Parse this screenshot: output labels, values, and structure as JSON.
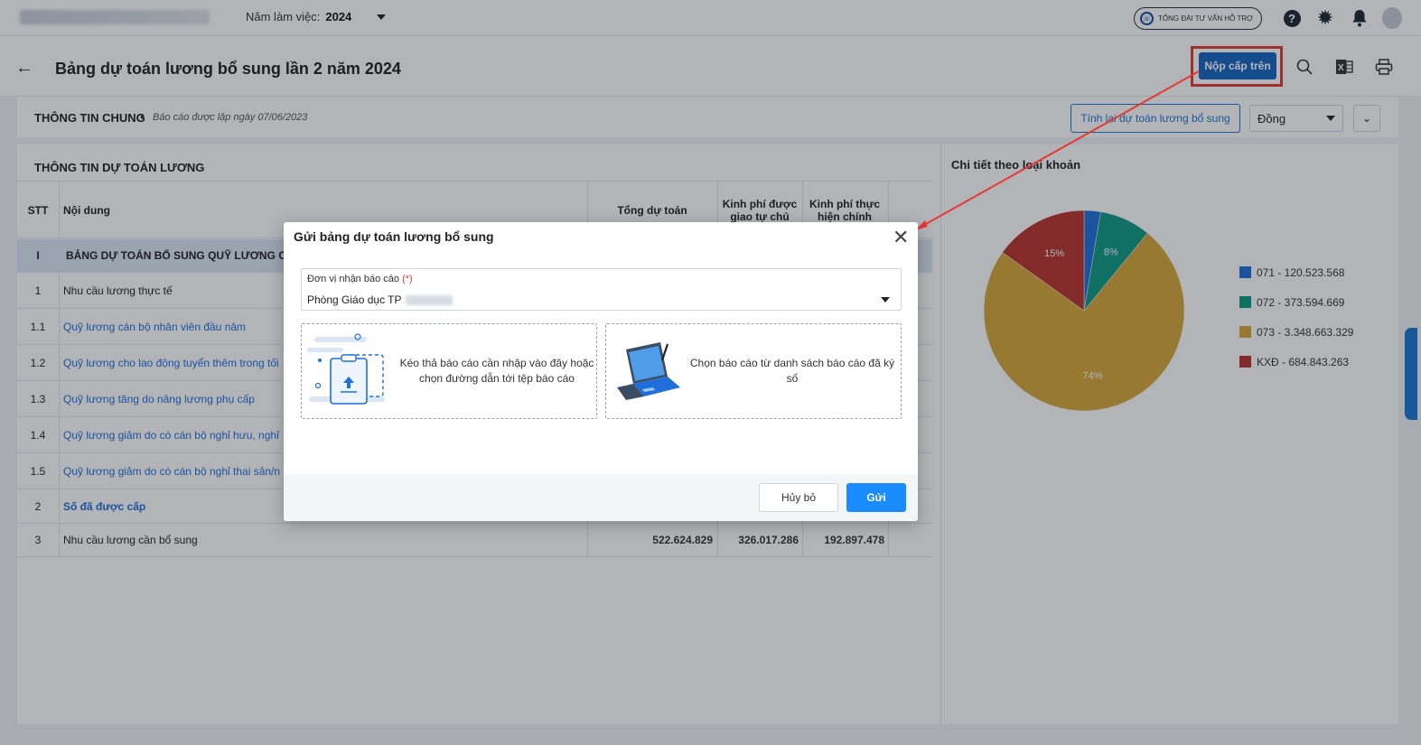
{
  "topbar": {
    "year_label": "Năm làm việc:",
    "year_value": "2024",
    "support_label": "TỔNG ĐÀI TƯ VẤN HỖ TRỢ",
    "help_glyph": "?"
  },
  "page": {
    "title": "Bảng dự toán lương bổ sung lần 2 năm 2024",
    "submit_label": "Nộp cấp trên"
  },
  "general": {
    "title": "THÔNG TIN CHUNG",
    "subtitle": "Báo cáo được lập ngày 07/06/2023",
    "recalc_label": "Tính lại dự toán lương bổ sung",
    "unit": "Đồng"
  },
  "table": {
    "title": "THÔNG TIN DỰ TOÁN LƯƠNG",
    "headers": {
      "stt": "STT",
      "content": "Nội dung",
      "total": "Tổng dự toán",
      "granted": "Kinh phí được giao tự chủ",
      "actual": "Kinh phí thực hiện chính"
    },
    "rows": [
      {
        "stt": "I",
        "content": "BẢNG DỰ TOÁN BỔ SUNG QUỸ LƯƠNG CHO"
      },
      {
        "stt": "1",
        "content": "Nhu cầu lương thực tế"
      },
      {
        "stt": "1.1",
        "content": "Quỹ lương cán bộ nhân viên đầu năm"
      },
      {
        "stt": "1.2",
        "content": "Quỹ lương cho lao động tuyển thêm trong tối"
      },
      {
        "stt": "1.3",
        "content": "Quỹ lương tăng do nâng lương phụ cấp"
      },
      {
        "stt": "1.4",
        "content": "Quỹ lương giảm do có cán bộ nghỉ hưu, nghỉ"
      },
      {
        "stt": "1.5",
        "content": "Quỹ lương giảm do có cán bộ nghỉ thai sản/n"
      },
      {
        "stt": "2",
        "content": "Số đã được cấp"
      },
      {
        "stt": "3",
        "content": "Nhu cầu lương cần bổ sung",
        "total": "522.624.829",
        "granted": "326.017.286",
        "actual": "192.897.478"
      }
    ]
  },
  "chart": {
    "title": "Chi tiết theo loại khoản",
    "colors": [
      "#1e6fd9",
      "#0e9a82",
      "#d7a73a",
      "#b9342e"
    ]
  },
  "chart_data": {
    "type": "pie",
    "categories": [
      "071",
      "072",
      "073",
      "KXĐ"
    ],
    "values": [
      120523568,
      373594669,
      3348663329,
      684843263
    ],
    "legend": [
      "071 - 120.523.568",
      "072 - 373.594.669",
      "073 - 3.348.663.329",
      "KXĐ - 684.843.263"
    ],
    "slice_labels": [
      "",
      "8%",
      "74%",
      "15%"
    ],
    "legend_position": "right"
  },
  "modal": {
    "title": "Gửi bảng dự toán lương bổ sung",
    "close_glyph": "✕",
    "field_label": "Đơn vị nhận báo cáo",
    "required_mark": "(*)",
    "field_value": "Phòng Giáo dục TP",
    "drop1_text": "Kéo thả báo cáo cần nhập vào đây hoặc chọn đường dẫn tới tệp báo cáo",
    "drop2_text": "Chọn báo cáo từ danh sách báo cáo đã ký số",
    "cancel_label": "Hủy bỏ",
    "send_label": "Gửi"
  }
}
